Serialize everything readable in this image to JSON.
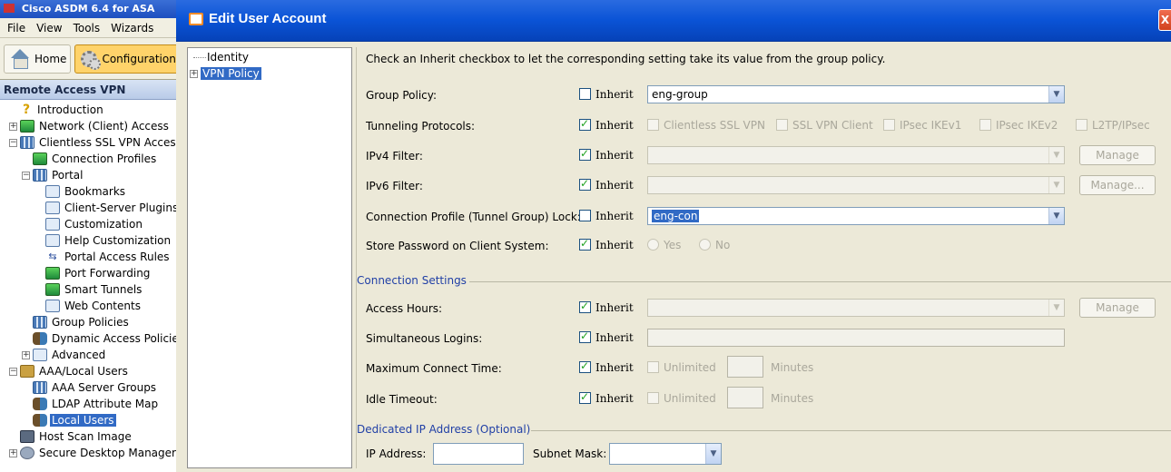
{
  "asdm": {
    "title": "Cisco ASDM 6.4 for ASA",
    "menu": [
      "File",
      "View",
      "Tools",
      "Wizards"
    ],
    "toolbar": {
      "home": "Home",
      "configuration": "Configuration"
    },
    "panel_title": "Remote Access VPN",
    "tree": [
      {
        "label": "Introduction",
        "icon": "question-icon"
      },
      {
        "label": "Network (Client) Access",
        "icon": "monitor-icon"
      },
      {
        "label": "Clientless SSL VPN Access",
        "icon": "grid-icon"
      },
      {
        "label": "Connection Profiles",
        "icon": "monitor-icon"
      },
      {
        "label": "Portal",
        "icon": "grid-icon"
      },
      {
        "label": "Bookmarks",
        "icon": "page-icon"
      },
      {
        "label": "Client-Server Plugins",
        "icon": "page-icon"
      },
      {
        "label": "Customization",
        "icon": "page-icon"
      },
      {
        "label": "Help Customization",
        "icon": "page-icon"
      },
      {
        "label": "Portal Access Rules",
        "icon": "arrows-icon"
      },
      {
        "label": "Port Forwarding",
        "icon": "monitor-icon"
      },
      {
        "label": "Smart Tunnels",
        "icon": "monitor-icon"
      },
      {
        "label": "Web Contents",
        "icon": "page-icon"
      },
      {
        "label": "Group Policies",
        "icon": "grid-icon"
      },
      {
        "label": "Dynamic Access Policies",
        "icon": "people-icon"
      },
      {
        "label": "Advanced",
        "icon": "page-icon"
      },
      {
        "label": "AAA/Local Users",
        "icon": "key-icon"
      },
      {
        "label": "AAA Server Groups",
        "icon": "grid-icon"
      },
      {
        "label": "LDAP Attribute Map",
        "icon": "people-icon"
      },
      {
        "label": "Local Users",
        "icon": "people-icon"
      },
      {
        "label": "Host Scan Image",
        "icon": "server-icon"
      },
      {
        "label": "Secure Desktop Manager",
        "icon": "gear-icon"
      }
    ]
  },
  "dialog": {
    "title": "Edit User Account",
    "close": "X",
    "nav": [
      "Identity",
      "VPN Policy"
    ],
    "instruction": "Check an Inherit checkbox to let the corresponding setting take its value from the group policy.",
    "inherit_label": "Inherit",
    "group_policy": {
      "label": "Group Policy:",
      "value": "eng-group"
    },
    "tunneling": {
      "label": "Tunneling Protocols:",
      "options": [
        "Clientless SSL VPN",
        "SSL VPN Client",
        "IPsec IKEv1",
        "IPsec IKEv2",
        "L2TP/IPsec"
      ]
    },
    "ipv4_filter": {
      "label": "IPv4 Filter:",
      "button": "Manage"
    },
    "ipv6_filter": {
      "label": "IPv6 Filter:",
      "button": "Manage..."
    },
    "conn_profile_lock": {
      "label": "Connection Profile (Tunnel Group) Lock:",
      "value": "eng-con"
    },
    "store_password": {
      "label": "Store Password on Client System:",
      "yes": "Yes",
      "no": "No"
    },
    "connection_settings": {
      "title": "Connection Settings",
      "access_hours": {
        "label": "Access Hours:",
        "button": "Manage"
      },
      "simultaneous_logins": {
        "label": "Simultaneous Logins:"
      },
      "max_connect_time": {
        "label": "Maximum Connect Time:",
        "unlimited": "Unlimited",
        "units": "Minutes"
      },
      "idle_timeout": {
        "label": "Idle Timeout:",
        "unlimited": "Unlimited",
        "units": "Minutes"
      }
    },
    "dedicated_ip": {
      "title": "Dedicated IP Address (Optional)",
      "ip_label": "IP Address:",
      "mask_label": "Subnet Mask:"
    }
  }
}
